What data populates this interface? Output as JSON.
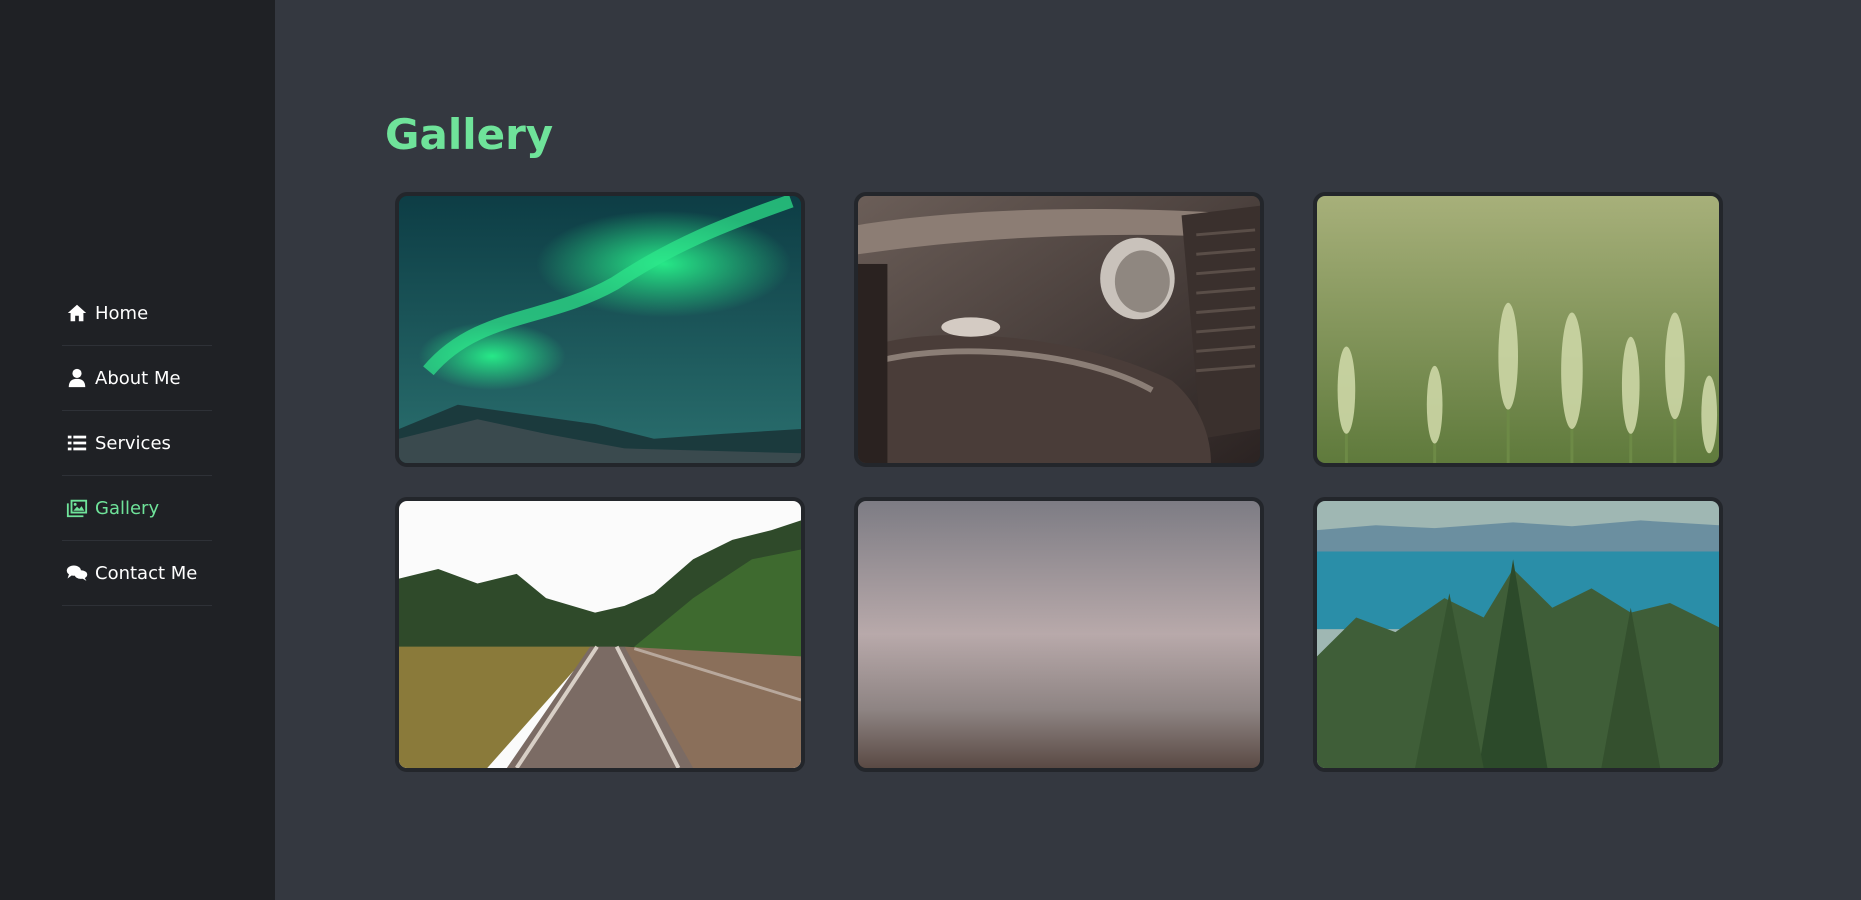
{
  "nav": {
    "items": [
      {
        "label": "Home",
        "icon": "home-icon",
        "active": false
      },
      {
        "label": "About Me",
        "icon": "user-icon",
        "active": false
      },
      {
        "label": "Services",
        "icon": "list-icon",
        "active": false
      },
      {
        "label": "Gallery",
        "icon": "images-icon",
        "active": true
      },
      {
        "label": "Contact Me",
        "icon": "comments-icon",
        "active": false
      }
    ]
  },
  "main": {
    "title": "Gallery",
    "gallery": [
      {
        "subject": "aurora-borealis"
      },
      {
        "subject": "vintage-car"
      },
      {
        "subject": "wheat-field"
      },
      {
        "subject": "railway-tracks"
      },
      {
        "subject": "misty-landscape"
      },
      {
        "subject": "lake-and-pines"
      }
    ]
  },
  "colors": {
    "accent": "#6fe39a",
    "sidebar_bg": "#1f2125",
    "main_bg": "#343840"
  }
}
